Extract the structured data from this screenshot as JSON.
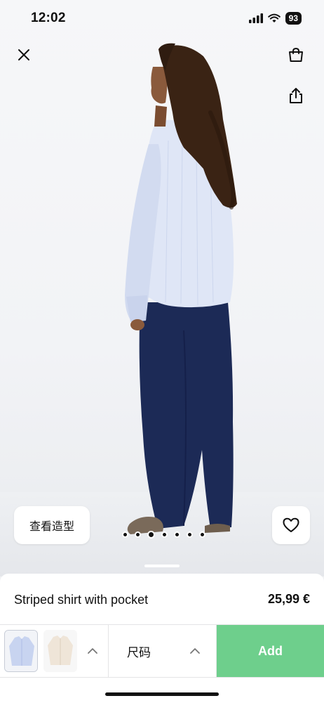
{
  "status_bar": {
    "time": "12:02",
    "battery": "93"
  },
  "header": {
    "close_icon": "close-icon",
    "bag_icon": "shopping-bag-icon",
    "share_icon": "share-icon"
  },
  "gallery": {
    "outfit_label": "查看造型",
    "favorite_icon": "heart-icon",
    "image_count": 7,
    "active_image": 3
  },
  "product": {
    "name": "Striped shirt with pocket",
    "price": "25,99 €"
  },
  "actions": {
    "size_label": "尺码",
    "add_label": "Add",
    "accent_color": "#6ecf8c"
  },
  "colors": {
    "shirt": "#dfe6f6",
    "trousers": "#1c2a56"
  }
}
